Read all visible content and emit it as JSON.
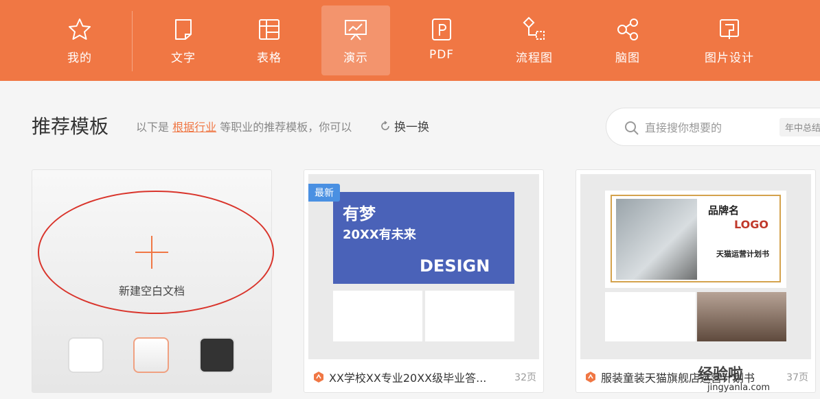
{
  "nav": {
    "items": [
      {
        "label": "我的",
        "icon": "star-icon"
      },
      {
        "label": "文字",
        "icon": "document-icon"
      },
      {
        "label": "表格",
        "icon": "table-icon"
      },
      {
        "label": "演示",
        "icon": "presentation-icon"
      },
      {
        "label": "PDF",
        "icon": "pdf-icon"
      },
      {
        "label": "流程图",
        "icon": "flowchart-icon"
      },
      {
        "label": "脑图",
        "icon": "mindmap-icon"
      },
      {
        "label": "图片设计",
        "icon": "image-design-icon"
      }
    ],
    "active": "演示",
    "color": "#f07744"
  },
  "header": {
    "title": "推荐模板",
    "sub_prefix": "以下是",
    "sub_link": "根据行业",
    "sub_suffix": "等职业的推荐模板，你可以",
    "swap_label": "换一换"
  },
  "search": {
    "placeholder": "直接搜你想要的",
    "tag": "年中总结"
  },
  "blank": {
    "label": "新建空白文档",
    "swatches": [
      "white",
      "gradient",
      "dark"
    ]
  },
  "templates": [
    {
      "badge": "最新",
      "title": "XX学校XX专业20XX级毕业答...",
      "pages": "32页",
      "thumb_text_1": "有梦",
      "thumb_text_2": "20XX有未来",
      "thumb_text_3": "DESIGN"
    },
    {
      "title": "服装童装天猫旗舰店运营计划书",
      "pages": "37页",
      "thumb_text_1": "品牌名",
      "thumb_text_2": "LOGO",
      "thumb_text_3": "天猫运营计划书"
    }
  ],
  "watermark": {
    "text": "经验啦",
    "sub": "jingyanla.com"
  }
}
